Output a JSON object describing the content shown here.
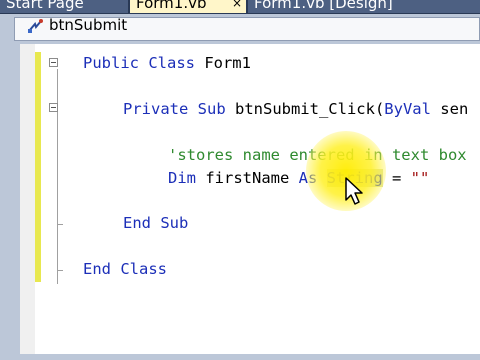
{
  "tabs": [
    {
      "label": "Start Page",
      "active": false
    },
    {
      "label": "Form1.vb",
      "active": true
    },
    {
      "label": "Form1.vb [Design]",
      "active": false
    }
  ],
  "tab_close_glyph": "×",
  "navbar": {
    "icon": "lightning-event-icon",
    "label": "btnSubmit"
  },
  "code": {
    "line1": {
      "kw1": "Public Class",
      "name": " Form1"
    },
    "line2": {
      "kw1": "Private Sub",
      "name": " btnSubmit_Click(",
      "kw2": "ByVal",
      "rest": " sen"
    },
    "line3": {
      "comment": "'stores name entered in text box"
    },
    "line4": {
      "kw1": "Dim",
      "mid": " firstName ",
      "kw2": "As",
      "sp": " ",
      "type": "String",
      "eq": " = ",
      "str": "\"\""
    },
    "line5": {
      "kw1": "End Sub"
    },
    "line6": {
      "kw1": "End Class"
    }
  },
  "colors": {
    "keyword": "#1c2fb8",
    "comment": "#2f8a2f",
    "string": "#a31515",
    "click_highlight": "#ffec00",
    "active_tab": "#fff6c9",
    "inactive_tab": "#4d6082"
  }
}
